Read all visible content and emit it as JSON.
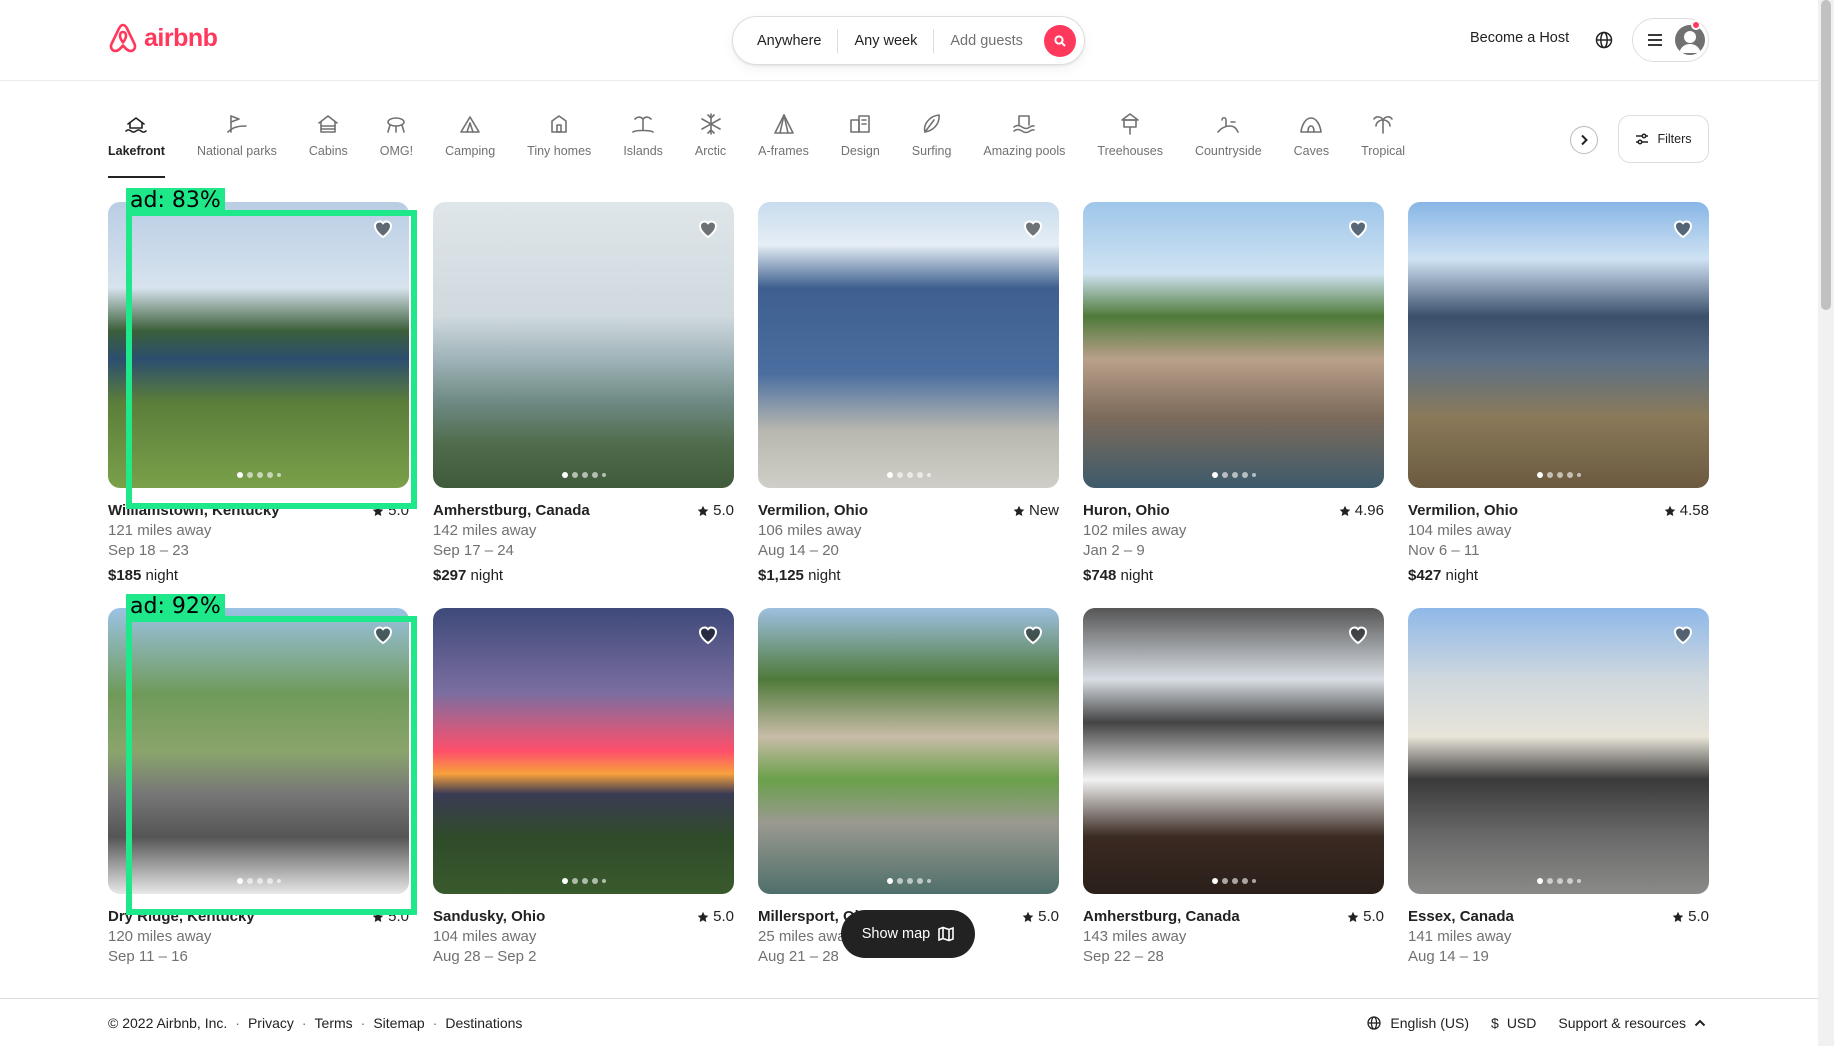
{
  "header": {
    "logo_text": "airbnb",
    "search": {
      "where": "Anywhere",
      "when": "Any week",
      "who": "Add guests"
    },
    "become_host": "Become a Host"
  },
  "categories": [
    {
      "label": "Lakefront",
      "icon": "lakefront-icon",
      "active": true
    },
    {
      "label": "National parks",
      "icon": "national-parks-icon"
    },
    {
      "label": "Cabins",
      "icon": "cabins-icon"
    },
    {
      "label": "OMG!",
      "icon": "omg-icon"
    },
    {
      "label": "Camping",
      "icon": "camping-icon"
    },
    {
      "label": "Tiny homes",
      "icon": "tiny-homes-icon"
    },
    {
      "label": "Islands",
      "icon": "islands-icon"
    },
    {
      "label": "Arctic",
      "icon": "arctic-icon"
    },
    {
      "label": "A-frames",
      "icon": "a-frames-icon"
    },
    {
      "label": "Design",
      "icon": "design-icon"
    },
    {
      "label": "Surfing",
      "icon": "surfing-icon"
    },
    {
      "label": "Amazing pools",
      "icon": "amazing-pools-icon"
    },
    {
      "label": "Treehouses",
      "icon": "treehouses-icon"
    },
    {
      "label": "Countryside",
      "icon": "countryside-icon"
    },
    {
      "label": "Caves",
      "icon": "caves-icon"
    },
    {
      "label": "Tropical",
      "icon": "tropical-icon"
    }
  ],
  "filters_label": "Filters",
  "listings": [
    {
      "location": "Williamstown, Kentucky",
      "rating": "5.0",
      "distance": "121 miles away",
      "dates": "Sep 18 – 23",
      "price": "$185",
      "price_unit": "night",
      "ad_label": "ad: 83%"
    },
    {
      "location": "Amherstburg, Canada",
      "rating": "5.0",
      "distance": "142 miles away",
      "dates": "Sep 17 – 24",
      "price": "$297",
      "price_unit": "night"
    },
    {
      "location": "Vermilion, Ohio",
      "rating": "New",
      "distance": "106 miles away",
      "dates": "Aug 14 – 20",
      "price": "$1,125",
      "price_unit": "night"
    },
    {
      "location": "Huron, Ohio",
      "rating": "4.96",
      "distance": "102 miles away",
      "dates": "Jan 2 – 9",
      "price": "$748",
      "price_unit": "night"
    },
    {
      "location": "Vermilion, Ohio",
      "rating": "4.58",
      "distance": "104 miles away",
      "dates": "Nov 6 – 11",
      "price": "$427",
      "price_unit": "night"
    },
    {
      "location": "Dry Ridge, Kentucky",
      "rating": "5.0",
      "distance": "120 miles away",
      "dates": "Sep 11 – 16",
      "ad_label": "ad: 92%"
    },
    {
      "location": "Sandusky, Ohio",
      "rating": "5.0",
      "distance": "104 miles away",
      "dates": "Aug 28 – Sep 2"
    },
    {
      "location": "Millersport, Ohio",
      "rating": "5.0",
      "distance": "25 miles away",
      "dates": "Aug 21 – 28"
    },
    {
      "location": "Amherstburg, Canada",
      "rating": "5.0",
      "distance": "143 miles away",
      "dates": "Sep 22 – 28"
    },
    {
      "location": "Essex, Canada",
      "rating": "5.0",
      "distance": "141 miles away",
      "dates": "Aug 14 – 19"
    }
  ],
  "show_map": "Show map",
  "footer": {
    "copyright": "© 2022 Airbnb, Inc.",
    "links": [
      "Privacy",
      "Terms",
      "Sitemap",
      "Destinations"
    ],
    "language": "English (US)",
    "currency_symbol": "$",
    "currency": "USD",
    "support": "Support & resources"
  },
  "colors": {
    "brand": "#ff385c",
    "detection_box": "#1ee88a",
    "text": "#222222",
    "muted": "#717171"
  }
}
